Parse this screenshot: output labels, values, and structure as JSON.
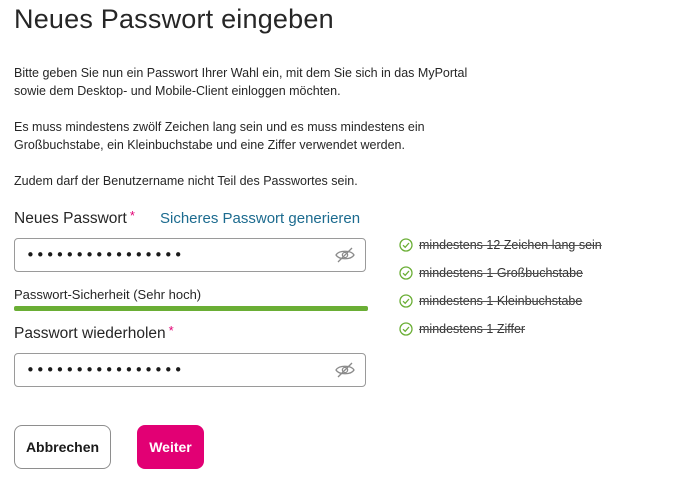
{
  "page": {
    "title": "Neues Passwort eingeben",
    "intro_line1": "Bitte geben Sie nun ein Passwort Ihrer Wahl ein, mit dem Sie sich in das MyPortal",
    "intro_line2": "sowie dem Desktop- und Mobile-Client einloggen möchten.",
    "requirements_line1": "Es muss mindestens zwölf Zeichen lang sein und es muss mindestens ein",
    "requirements_line2": "Großbuchstabe, ein Kleinbuchstabe und eine Ziffer verwendet werden.",
    "username_note": "Zudem darf der Benutzername nicht Teil des Passwortes sein."
  },
  "new_password": {
    "label": "Neues Passwort",
    "required_mark": "*",
    "generate_link": "Sicheres Passwort generieren",
    "value": "••••••••••••••••"
  },
  "strength": {
    "label": "Passwort-Sicherheit (Sehr hoch)",
    "fraction": 1.0,
    "color": "#6aae35"
  },
  "repeat_password": {
    "label": "Passwort wiederholen",
    "required_mark": "*",
    "value": "••••••••••••••••"
  },
  "rules": [
    {
      "text": "mindestens 12 Zeichen lang sein",
      "satisfied": true
    },
    {
      "text": "mindestens 1 Großbuchstabe",
      "satisfied": true
    },
    {
      "text": "mindestens 1 Kleinbuchstabe",
      "satisfied": true
    },
    {
      "text": "mindestens 1 Ziffer",
      "satisfied": true
    }
  ],
  "buttons": {
    "cancel": "Abbrechen",
    "next": "Weiter"
  },
  "colors": {
    "accent": "#e20074",
    "link": "#1c6b8f",
    "check": "#6aae35"
  },
  "icons": {
    "visibility_toggle": "eye-slash-icon",
    "rule_check": "check-circle-icon"
  }
}
